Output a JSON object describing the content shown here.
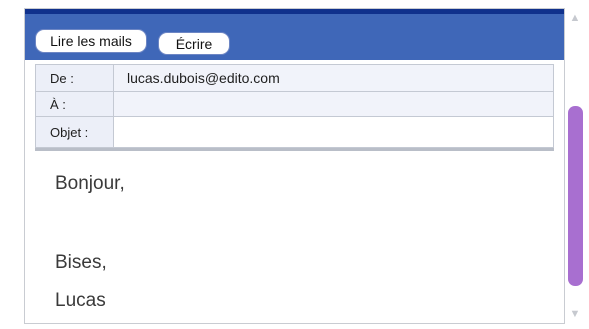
{
  "toolbar": {
    "read_mail_label": "Lire les mails",
    "write_label": "Écrire"
  },
  "headers": {
    "from_label": "De :",
    "from_value": "lucas.dubois@edito.com",
    "to_label": "À :",
    "to_value": "",
    "subject_label": "Objet :",
    "subject_value": ""
  },
  "message": {
    "greeting": "Bonjour,",
    "closing": "Bises,",
    "signature": "Lucas"
  },
  "colors": {
    "topbar": "#3f67b8",
    "topbar_edge": "#10318c",
    "scroll_thumb": "#a86fd0"
  },
  "icons": {
    "scroll_up": "arrow-up-icon",
    "scroll_down": "arrow-down-icon"
  },
  "scroll": {
    "position_fraction": 0.4
  }
}
